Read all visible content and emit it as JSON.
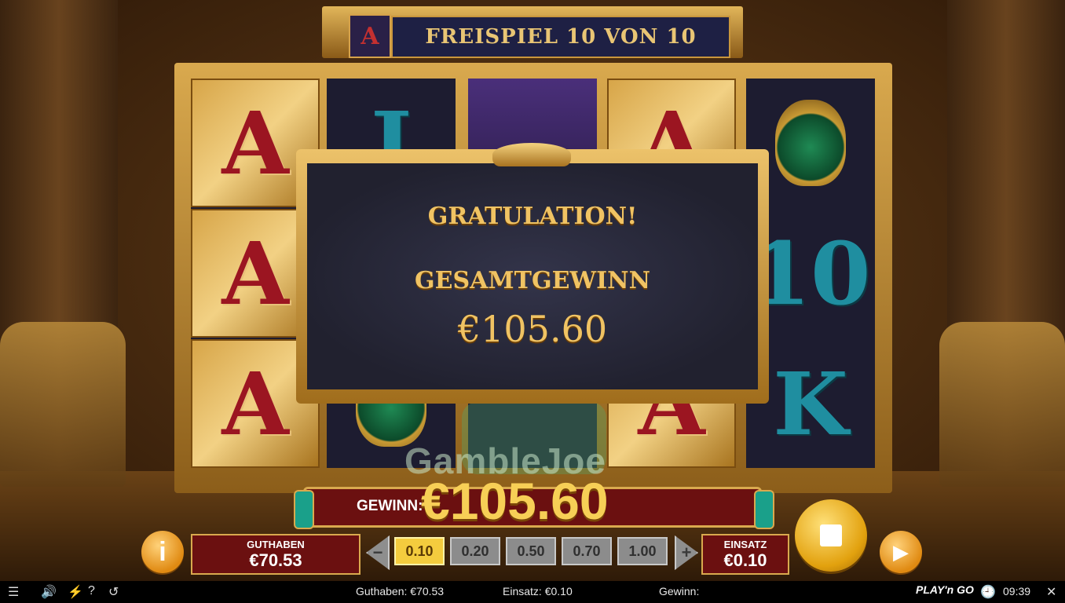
{
  "title": {
    "icon_letter": "A",
    "text": "FREISPIEL 10 VON 10"
  },
  "reels": [
    [
      {
        "sym": "A",
        "style": "red"
      },
      {
        "sym": "A",
        "style": "red"
      },
      {
        "sym": "A",
        "style": "red"
      }
    ],
    [
      {
        "sym": "J",
        "style": "teal"
      },
      {
        "sym": "",
        "style": "dark"
      },
      {
        "sym": "",
        "style": "scarab"
      }
    ],
    [
      {
        "sym": "",
        "style": "mummy"
      },
      {
        "sym": "",
        "style": "dark"
      },
      {
        "sym": "",
        "style": "dark"
      }
    ],
    [
      {
        "sym": "A",
        "style": "red"
      },
      {
        "sym": "",
        "style": "dark"
      },
      {
        "sym": "A",
        "style": "red"
      }
    ],
    [
      {
        "sym": "",
        "style": "scarab"
      },
      {
        "sym": "10",
        "style": "teal"
      },
      {
        "sym": "K",
        "style": "teal"
      }
    ]
  ],
  "dialog": {
    "congrats": "GRATULATION!",
    "total_label": "GESAMTGEWINN",
    "total_amount": "€105.60"
  },
  "watermark": "GambleJoe",
  "win": {
    "label": "GEWINN:",
    "amount": "€105.60"
  },
  "balance": {
    "label": "GUTHABEN",
    "value": "€70.53"
  },
  "bet_options": [
    "0.10",
    "0.20",
    "0.50",
    "0.70",
    "1.00"
  ],
  "bet_selected_index": 0,
  "bet": {
    "label": "EINSATZ",
    "value": "€0.10"
  },
  "buttons": {
    "info": "i",
    "arrow_left": "−",
    "arrow_right": "+"
  },
  "bottom_bar": {
    "balance": "Guthaben: €70.53",
    "bet": "Einsatz: €0.10",
    "win": "Gewinn:",
    "brand": "PLAY'n GO",
    "time": "09:39",
    "help": "?"
  }
}
